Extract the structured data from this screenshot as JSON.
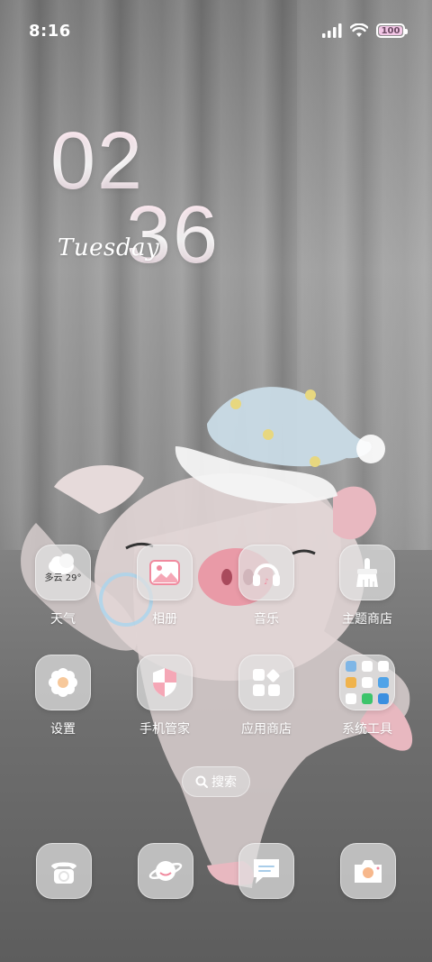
{
  "status_bar": {
    "time": "8:16",
    "battery_level": "100",
    "icons": [
      "signal-icon",
      "wifi-icon",
      "battery-icon"
    ]
  },
  "clock": {
    "hours": "02",
    "minutes": "36",
    "day": "Tuesday"
  },
  "apps": [
    {
      "label": "天气",
      "icon": "weather-icon",
      "widget_text": "多云 29°"
    },
    {
      "label": "相册",
      "icon": "gallery-icon"
    },
    {
      "label": "音乐",
      "icon": "headphones-icon"
    },
    {
      "label": "主题商店",
      "icon": "theme-brush-icon"
    },
    {
      "label": "设置",
      "icon": "gear-icon"
    },
    {
      "label": "手机管家",
      "icon": "shield-icon"
    },
    {
      "label": "应用商店",
      "icon": "app-store-icon"
    },
    {
      "label": "系统工具",
      "icon": "folder-icon"
    }
  ],
  "search": {
    "label": "搜索",
    "icon": "search-icon"
  },
  "dock": [
    {
      "icon": "phone-icon"
    },
    {
      "icon": "browser-planet-icon"
    },
    {
      "icon": "message-icon"
    },
    {
      "icon": "camera-icon"
    }
  ],
  "colors": {
    "accent_pink": "#f08a9e",
    "icon_bg": "#e1e1e1",
    "battery_fill": "#f3c7e6"
  }
}
